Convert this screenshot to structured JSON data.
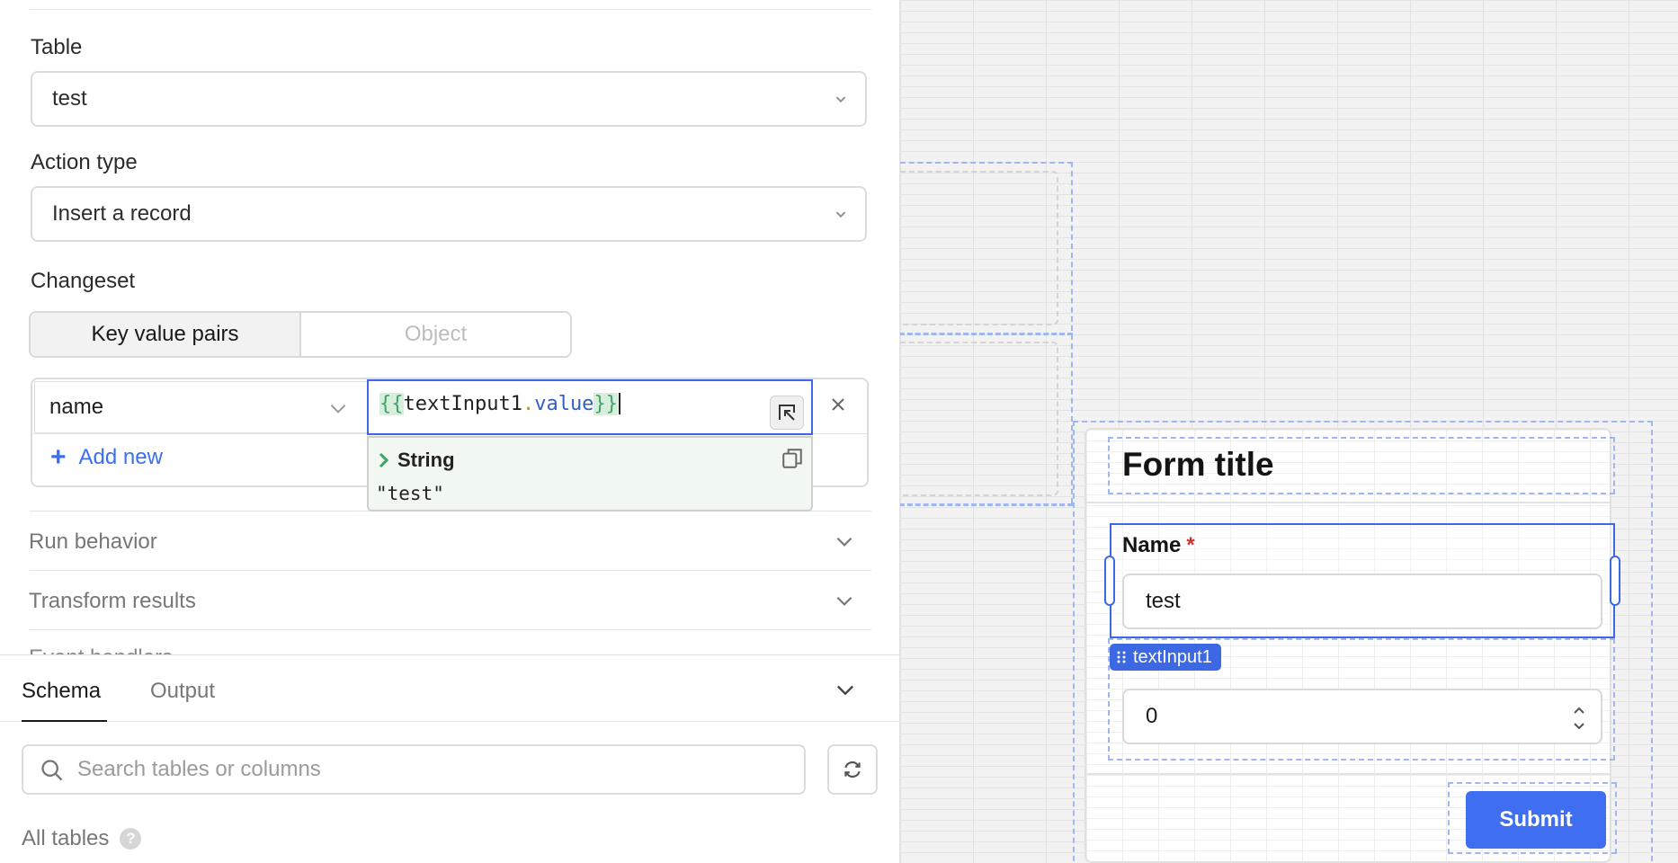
{
  "query_editor": {
    "table_label": "Table",
    "table_value": "test",
    "action_type_label": "Action type",
    "action_type_value": "Insert a record",
    "changeset_label": "Changeset",
    "changeset_modes": [
      "Key value pairs",
      "Object"
    ],
    "changeset_active_mode": "Key value pairs",
    "pairs": [
      {
        "key": "name",
        "value": "{{textInput1.value}}"
      }
    ],
    "code_tokens": {
      "open": "{{",
      "ident": "textInput1",
      "dot": ".",
      "prop": "value",
      "close": "}}"
    },
    "preview_type": "String",
    "preview_value": "\"test\"",
    "add_new_label": "Add new",
    "sections": [
      "Run behavior",
      "Transform results",
      "Event handlers"
    ]
  },
  "bottom_panel": {
    "tabs": [
      "Schema",
      "Output"
    ],
    "active_tab": "Schema",
    "search_placeholder": "Search tables or columns",
    "all_tables_label": "All tables",
    "help_glyph": "?"
  },
  "canvas": {
    "form_title": "Form title",
    "name_label": "Name",
    "required_mark": "*",
    "name_value": "test",
    "selected_component": "textInput1",
    "number_value": "0",
    "submit_label": "Submit"
  },
  "colors": {
    "accent": "#3c68e3",
    "submit": "#3f6ef0",
    "required": "#d32f2f",
    "code_brace_bg": "#d6eedc",
    "preview_bg": "#f1f8f2"
  },
  "icons": [
    "chevron-down-icon",
    "close-icon",
    "plus-icon",
    "expand-icon",
    "chevron-right-icon",
    "copy-icon",
    "search-icon",
    "refresh-icon",
    "help-icon",
    "drag-handle-icon",
    "stepper-icon"
  ]
}
